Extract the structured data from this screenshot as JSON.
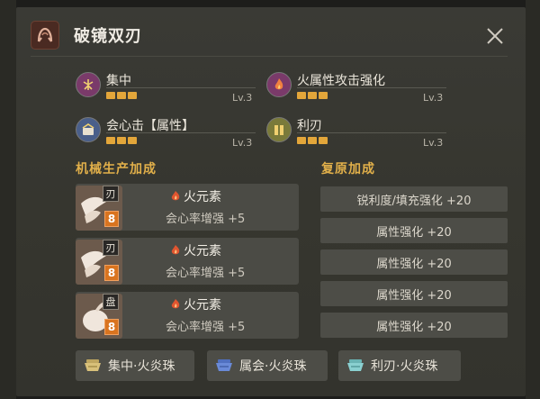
{
  "header": {
    "title": "破镜双刃",
    "weapon_icon": "weapon-type-icon"
  },
  "skills": [
    {
      "name": "集中",
      "level": "Lv.3",
      "filled": 3,
      "icon": "focus-skill-icon",
      "color": "#7a3a6a"
    },
    {
      "name": "火属性攻击强化",
      "level": "Lv.3",
      "filled": 3,
      "icon": "fire-attack-skill-icon",
      "color": "#7a3a6a"
    },
    {
      "name": "会心击【属性】",
      "level": "Lv.3",
      "filled": 3,
      "icon": "critical-element-skill-icon",
      "color": "#4a5f8a"
    },
    {
      "name": "利刃",
      "level": "Lv.3",
      "filled": 3,
      "icon": "razor-sharp-skill-icon",
      "color": "#7a7a3a"
    }
  ],
  "sections": {
    "machine": "机械生产加成",
    "restore": "复原加成"
  },
  "craft_items": [
    {
      "tag": "刃",
      "num": "8",
      "element": "火元素",
      "desc": "会心率增强 +5"
    },
    {
      "tag": "刃",
      "num": "8",
      "element": "火元素",
      "desc": "会心率增强 +5"
    },
    {
      "tag": "盘",
      "num": "8",
      "element": "火元素",
      "desc": "会心率增强 +5"
    }
  ],
  "restore_items": [
    "锐利度/填充强化 +20",
    "属性强化 +20",
    "属性强化 +20",
    "属性强化 +20",
    "属性强化 +20"
  ],
  "jewels": [
    {
      "label": "集中·火炎珠",
      "color": "#d8c07a"
    },
    {
      "label": "属会·火炎珠",
      "color": "#6a8ad8"
    },
    {
      "label": "利刃·火炎珠",
      "color": "#8ad0d0"
    }
  ],
  "colors": {
    "accent": "#e2b04a",
    "pip": "#e3a63a",
    "fire": "#e05530"
  }
}
